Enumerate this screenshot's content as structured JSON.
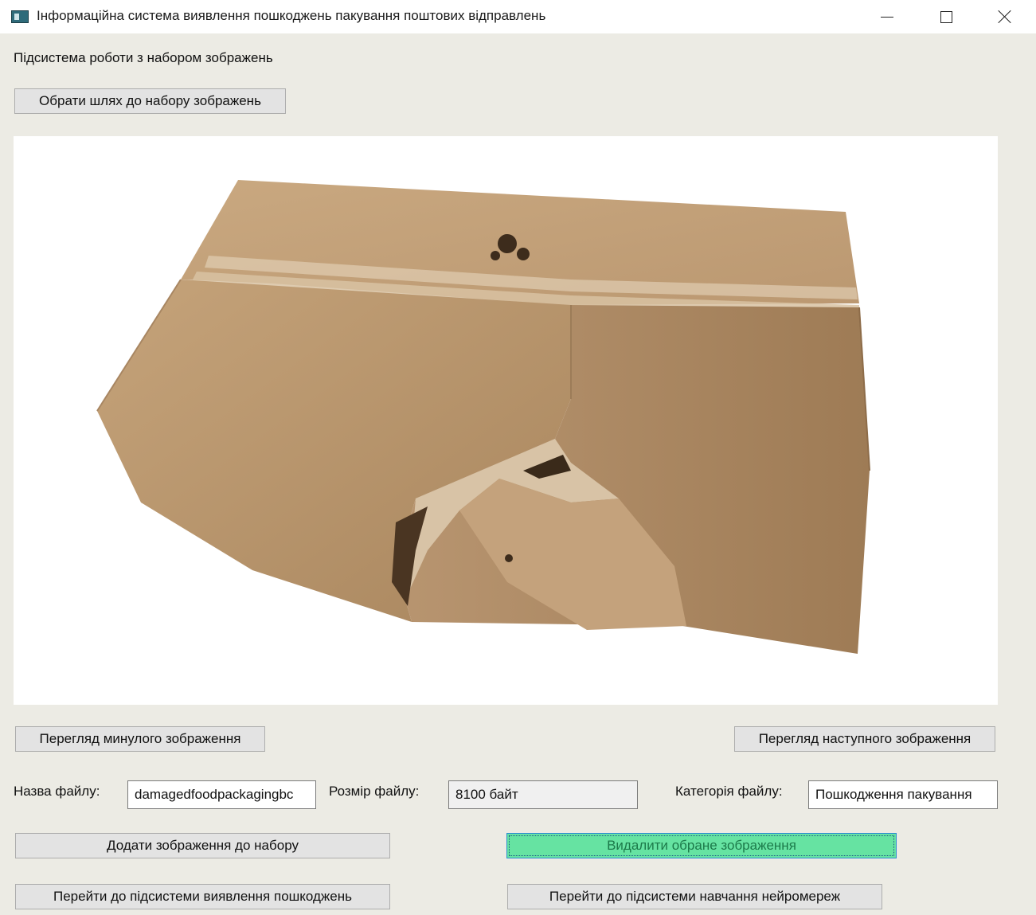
{
  "window": {
    "title": "Інформаційна система виявлення пошкоджень пакування поштових відправлень"
  },
  "subsystem_label": "Підсистема роботи з набором зображень",
  "choose_path_button": "Обрати шлях до набору зображень",
  "image": {
    "icon": "damaged-cardboard-box"
  },
  "nav": {
    "prev_button": "Перегляд минулого зображення",
    "next_button": "Перегляд наступного зображення"
  },
  "file_info": {
    "name_label": "Назва файлу:",
    "name_value": "damagedfoodpackagingbc",
    "size_label": "Розмір файлу:",
    "size_value": "8100 байт",
    "category_label": "Категорія файлу:",
    "category_value": "Пошкодження пакування"
  },
  "actions": {
    "add_button": "Додати зображення до набору",
    "delete_button": "Видалити обране зображення",
    "goto_detection_button": "Перейти до підсистеми виявлення пошкоджень",
    "goto_training_button": "Перейти до підсистеми навчання нейромереж"
  },
  "colors": {
    "window_bg": "#ecebe4",
    "selected_button_bg": "#66e3a2",
    "selected_button_text": "#1c7a4a"
  }
}
